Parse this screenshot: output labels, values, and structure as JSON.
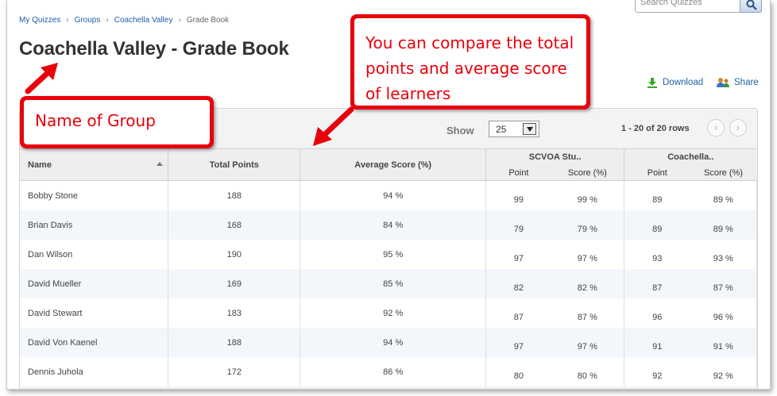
{
  "breadcrumb": [
    "My Quizzes",
    "Groups",
    "Coachella Valley",
    "Grade Book"
  ],
  "breadcrumb_separator": "›",
  "search": {
    "value": "Search Quizzes"
  },
  "page_title": "Coachella Valley - Grade Book",
  "actions": {
    "download": "Download",
    "share": "Share"
  },
  "pager": {
    "show_label": "Show",
    "page_size": "25",
    "row_count": "1 - 20 of 20 rows",
    "prev": "‹",
    "next": "›"
  },
  "columns": {
    "name": "Name",
    "total_points": "Total Points",
    "average_score": "Average Score (%)",
    "group1": "SCVOA Stu..",
    "group2": "Coachella..",
    "point": "Point",
    "score": "Score (%)"
  },
  "rows": [
    {
      "name": "Bobby Stone",
      "total": "188",
      "avg": "94 %",
      "g1p": "99",
      "g1s": "99 %",
      "g2p": "89",
      "g2s": "89 %"
    },
    {
      "name": "Brian Davis",
      "total": "168",
      "avg": "84 %",
      "g1p": "79",
      "g1s": "79 %",
      "g2p": "89",
      "g2s": "89 %"
    },
    {
      "name": "Dan Wilson",
      "total": "190",
      "avg": "95 %",
      "g1p": "97",
      "g1s": "97 %",
      "g2p": "93",
      "g2s": "93 %"
    },
    {
      "name": "David Mueller",
      "total": "169",
      "avg": "85 %",
      "g1p": "82",
      "g1s": "82 %",
      "g2p": "87",
      "g2s": "87 %"
    },
    {
      "name": "David Stewart",
      "total": "183",
      "avg": "92 %",
      "g1p": "87",
      "g1s": "87 %",
      "g2p": "96",
      "g2s": "96 %"
    },
    {
      "name": "David Von Kaenel",
      "total": "188",
      "avg": "94 %",
      "g1p": "97",
      "g1s": "97 %",
      "g2p": "91",
      "g2s": "91 %"
    },
    {
      "name": "Dennis Juhola",
      "total": "172",
      "avg": "86 %",
      "g1p": "80",
      "g1s": "80 %",
      "g2p": "92",
      "g2s": "92 %"
    }
  ],
  "annotations": {
    "compare": "You can compare the total points and average score of learners",
    "name_of_group": "Name of Group"
  },
  "colors": {
    "callout": "#e8000b",
    "link": "#1f5fa8",
    "row_alt": "#f3f6fa"
  }
}
